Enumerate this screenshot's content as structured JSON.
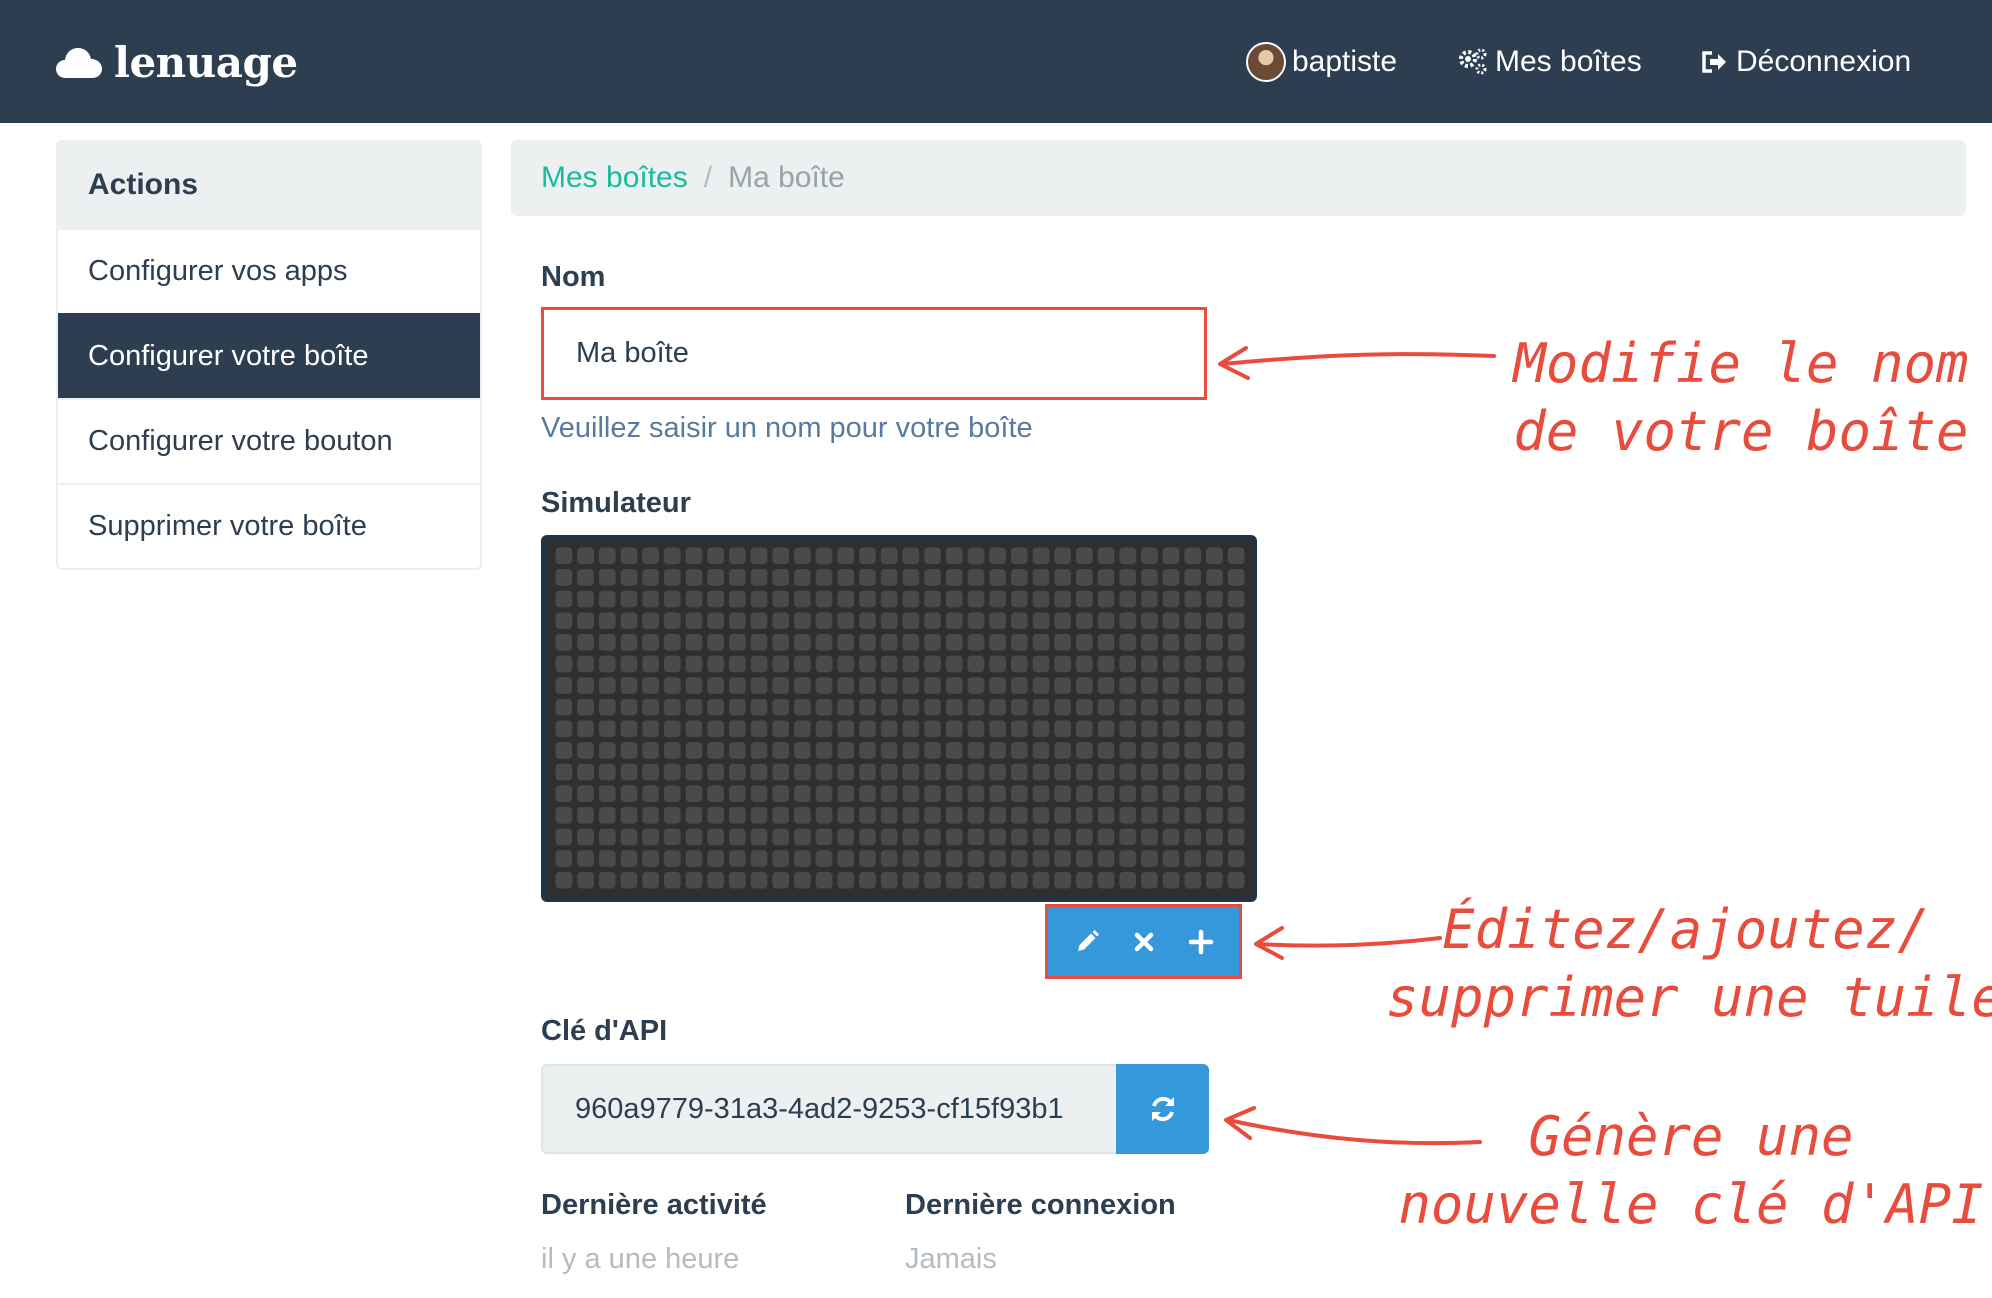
{
  "navbar": {
    "brand": "lenuage",
    "user": "baptiste",
    "boxes": "Mes boîtes",
    "logout": "Déconnexion"
  },
  "sidebar": {
    "heading": "Actions",
    "items": [
      {
        "label": "Configurer vos apps",
        "active": false
      },
      {
        "label": "Configurer votre boîte",
        "active": true
      },
      {
        "label": "Configurer votre bouton",
        "active": false
      },
      {
        "label": "Supprimer votre boîte",
        "active": false
      }
    ]
  },
  "breadcrumb": {
    "parent": "Mes boîtes",
    "separator": "/",
    "current": "Ma boîte"
  },
  "form": {
    "name_label": "Nom",
    "name_value": "Ma boîte",
    "name_help": "Veuillez saisir un nom pour votre boîte",
    "simulator_label": "Simulateur",
    "api_label": "Clé d'API",
    "api_value": "960a9779-31a3-4ad2-9253-cf15f93b1",
    "last_activity_label": "Dernière activité",
    "last_activity_value": "il y a une heure",
    "last_connection_label": "Dernière connexion",
    "last_connection_value": "Jamais"
  },
  "annotations": {
    "name": [
      "Modifie le nom",
      "de votre boîte"
    ],
    "tile": [
      "Éditez/ajoutez/",
      "supprimer une tuile"
    ],
    "api": [
      "Génère une",
      "nouvelle clé d'API"
    ]
  },
  "colors": {
    "navbar": "#2c3e50",
    "primary": "#3498db",
    "success": "#18bc9c",
    "annotation": "#e74c3c"
  },
  "icons": {
    "brand": "cloud-icon",
    "boxes": "gears-icon",
    "logout": "sign-out-icon",
    "edit": "pencil-icon",
    "delete": "times-icon",
    "add": "plus-icon",
    "refresh": "refresh-icon"
  }
}
